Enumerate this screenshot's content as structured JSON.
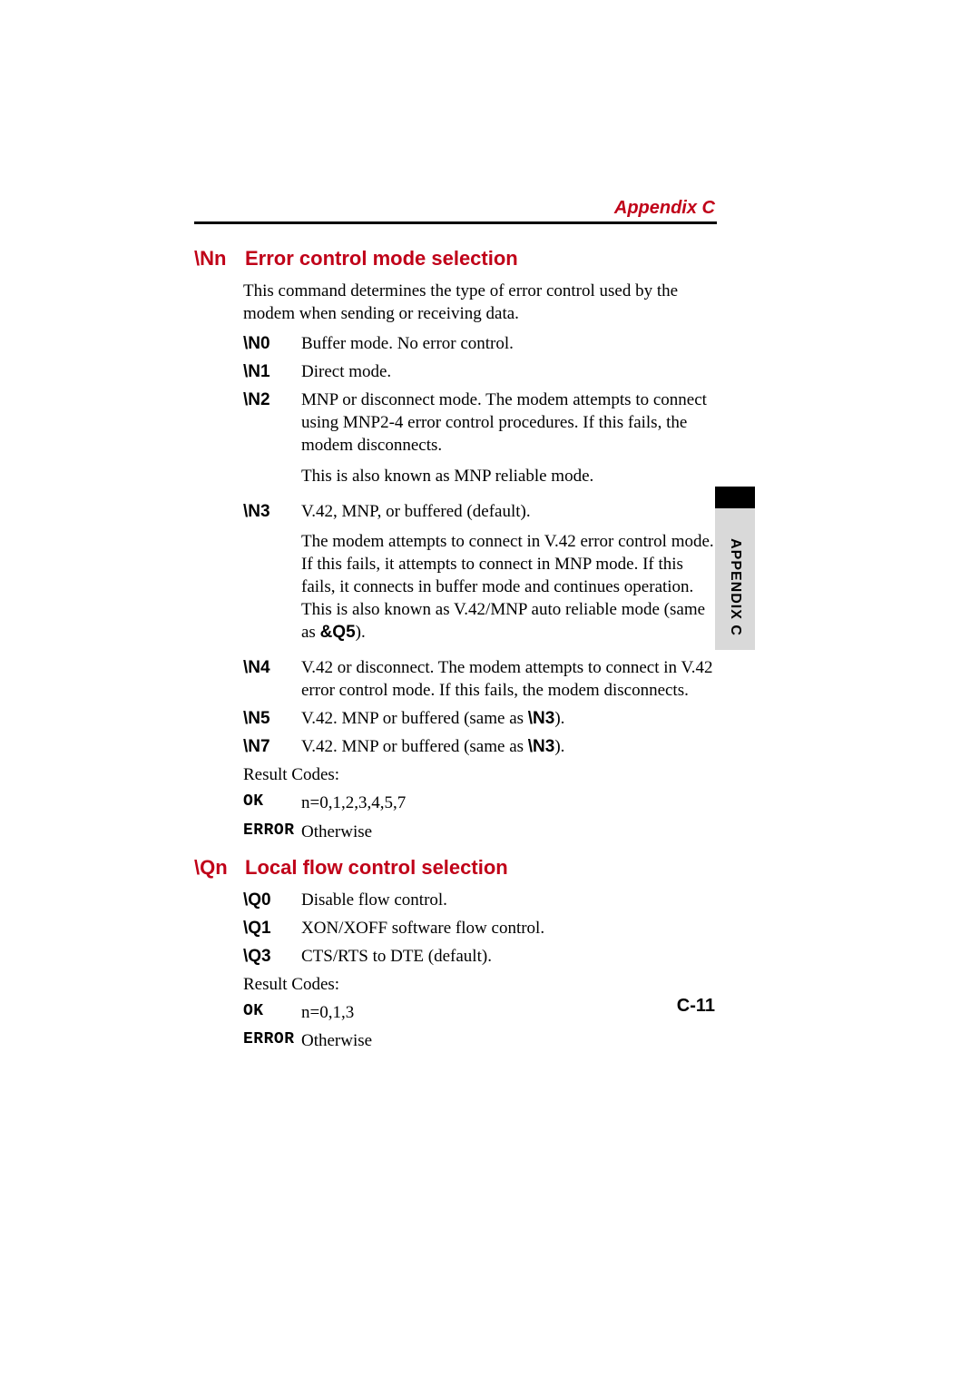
{
  "running_head": "Appendix C",
  "page_number": "C-11",
  "side_tab": "APPENDIX C",
  "sections": {
    "nn": {
      "cmd": "\\Nn",
      "title": "Error control mode selection",
      "intro": "This command determines the type of error control used by the modem when sending or receiving data.",
      "items": {
        "n0": {
          "label": "\\N0",
          "text": "Buffer mode. No error control."
        },
        "n1": {
          "label": "\\N1",
          "text": "Direct mode."
        },
        "n2": {
          "label": "\\N2",
          "p1": "MNP or disconnect mode. The modem attempts to connect using MNP2-4 error control procedures. If this fails, the modem disconnects.",
          "p2": "This is also known as MNP reliable mode."
        },
        "n3": {
          "label": "\\N3",
          "p1": "V.42, MNP, or buffered (default).",
          "p2_a": "The modem attempts to connect in V.42 error control mode. If this fails, it attempts to connect in MNP mode. If this fails, it connects in buffer mode and continues operation. This is also known as V.42/MNP auto reliable mode (same as ",
          "p2_b": "&Q5",
          "p2_c": ")."
        },
        "n4": {
          "label": "\\N4",
          "text": "V.42 or disconnect. The modem attempts to connect in V.42 error control mode. If this fails, the modem disconnects."
        },
        "n5": {
          "label": "\\N5",
          "a": "V.42. MNP or buffered (same as ",
          "b": "\\N3",
          "c": ")."
        },
        "n7": {
          "label": "\\N7",
          "a": "V.42. MNP or buffered (same as ",
          "b": "\\N3",
          "c": ")."
        }
      },
      "result_label": "Result Codes:",
      "ok": {
        "label": "OK",
        "text": "n=0,1,2,3,4,5,7"
      },
      "error": {
        "label": "ERROR",
        "text": "Otherwise"
      }
    },
    "qn": {
      "cmd": "\\Qn",
      "title": "Local flow control selection",
      "items": {
        "q0": {
          "label": "\\Q0",
          "text": "Disable flow control."
        },
        "q1": {
          "label": "\\Q1",
          "text": "XON/XOFF software flow control."
        },
        "q3": {
          "label": "\\Q3",
          "text": "CTS/RTS to DTE (default)."
        }
      },
      "result_label": "Result Codes:",
      "ok": {
        "label": "OK",
        "text": "n=0,1,3"
      },
      "error": {
        "label": "ERROR",
        "text": "Otherwise"
      }
    }
  }
}
